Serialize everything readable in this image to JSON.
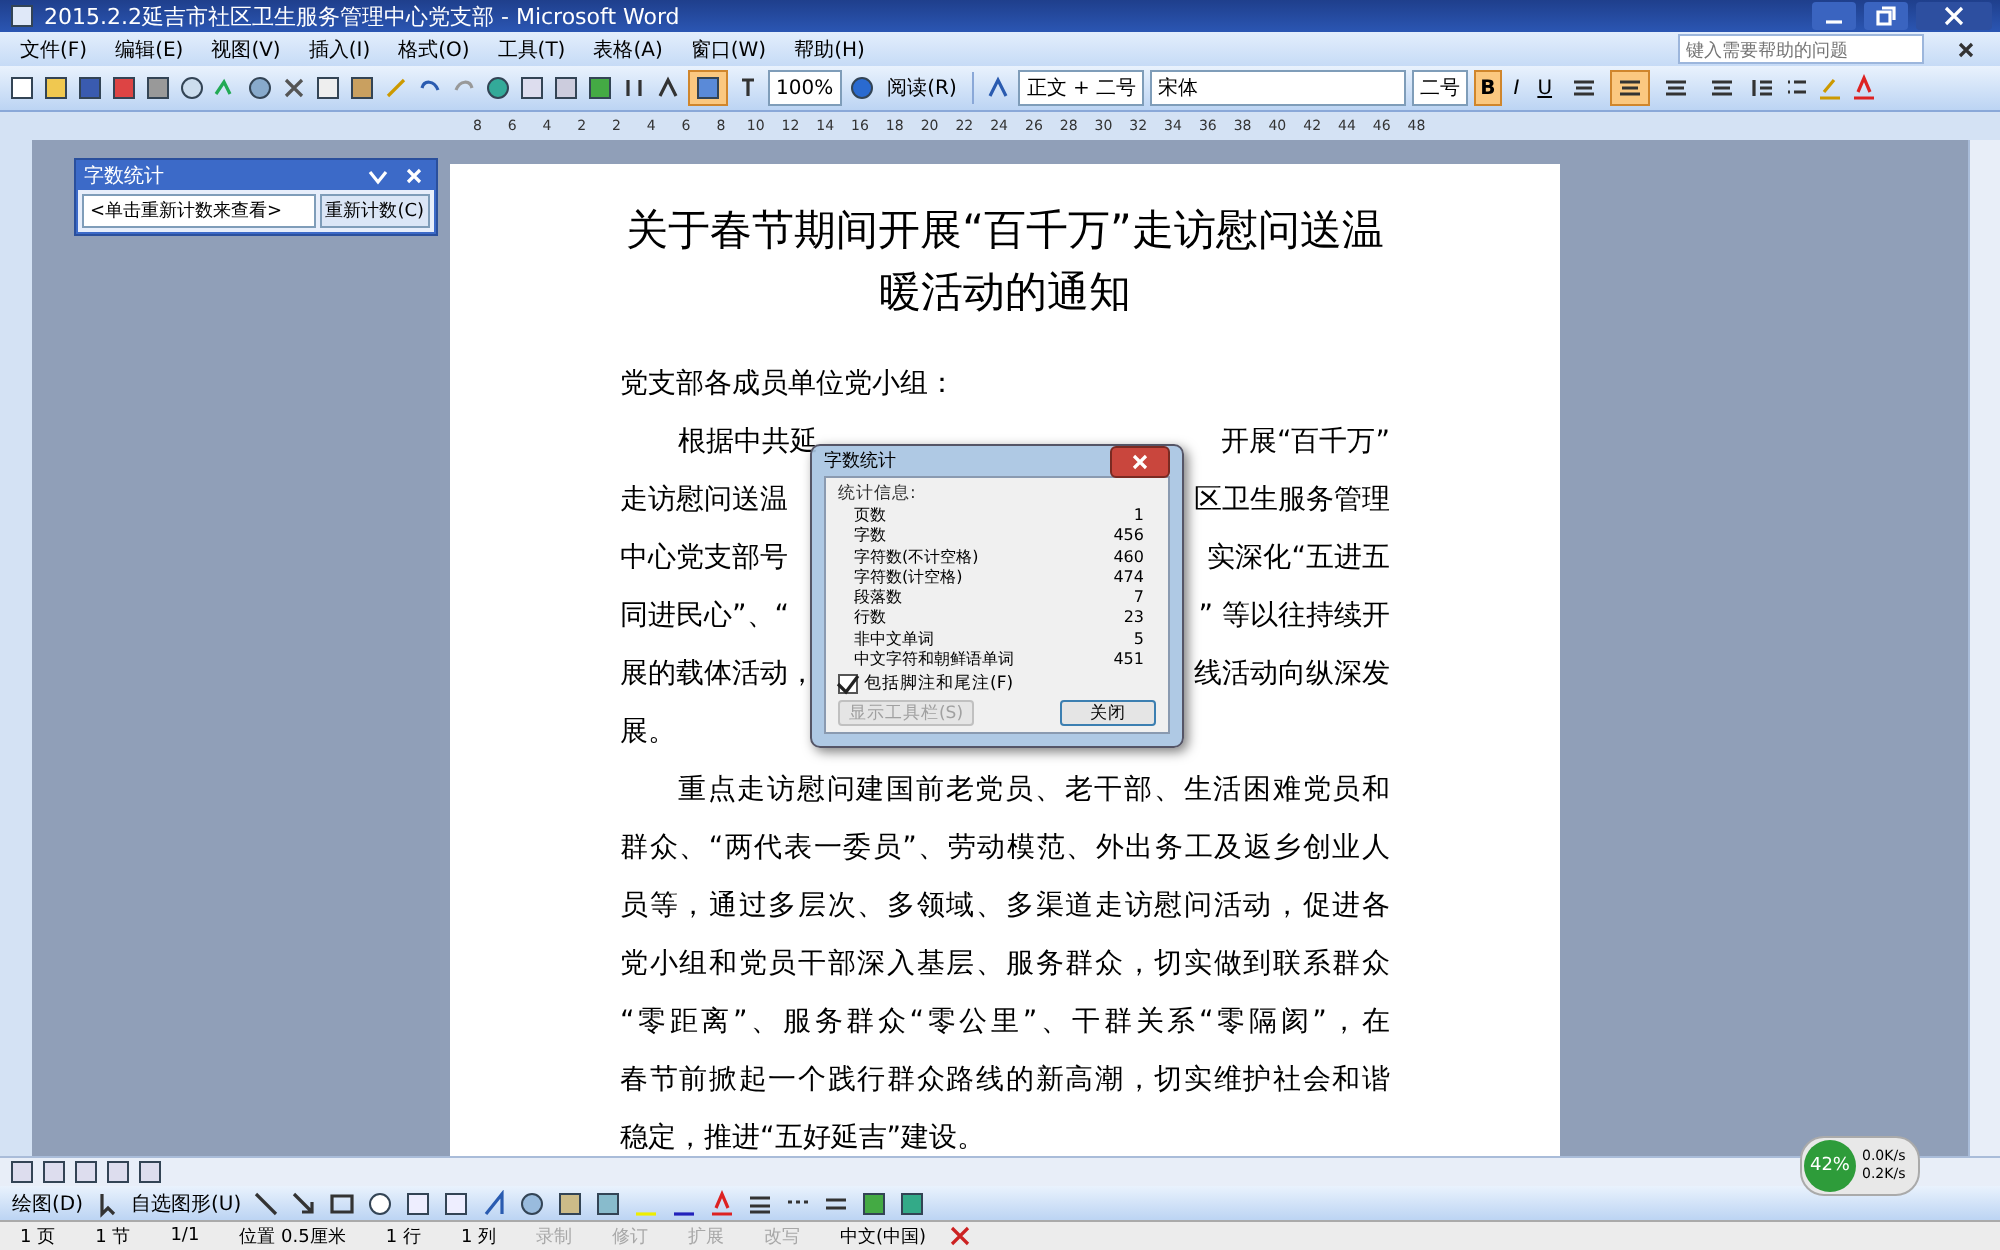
{
  "window": {
    "title": "2015.2.2延吉市社区卫生服务管理中心党支部 - Microsoft Word"
  },
  "menu": [
    "文件(F)",
    "编辑(E)",
    "视图(V)",
    "插入(I)",
    "格式(O)",
    "工具(T)",
    "表格(A)",
    "窗口(W)",
    "帮助(H)"
  ],
  "help_box": {
    "placeholder": "键入需要帮助的问题"
  },
  "standard_toolbar": {
    "zoom": "100%",
    "read_button": "阅读(R)"
  },
  "formatting_toolbar": {
    "style": "正文 + 二号",
    "font": "宋体",
    "size": "二号",
    "text_buttons": [
      {
        "label": "B",
        "selected": true
      },
      {
        "label": "I",
        "selected": false
      },
      {
        "label": "U",
        "selected": false
      }
    ],
    "alignment": [
      {
        "selected": false
      },
      {
        "selected": true
      },
      {
        "selected": false
      },
      {
        "selected": false
      }
    ]
  },
  "ruler": {
    "labels": [
      "8",
      "6",
      "4",
      "2",
      "2",
      "4",
      "6",
      "8",
      "10",
      "12",
      "14",
      "16",
      "18",
      "20",
      "22",
      "24",
      "26",
      "28",
      "30",
      "32",
      "34",
      "36",
      "38",
      "40",
      "42",
      "44",
      "46",
      "48"
    ]
  },
  "word_count_pane": {
    "title": "字数统计",
    "field": "<单击重新计数来查看>",
    "button": "重新计数(C)"
  },
  "document": {
    "title_lines": [
      "关于春节期间开展“百千万”走访慰问送温",
      "暖活动的通知"
    ],
    "salutation": "党支部各成员单位党小组：",
    "lines": [
      {
        "kind": "split",
        "indent": true,
        "left": "根据中共延",
        "right": "开展“百千万”"
      },
      {
        "kind": "split",
        "indent": false,
        "left": "走访慰问送温",
        "right": "区卫生服务管理"
      },
      {
        "kind": "split",
        "indent": false,
        "left": "中心党支部号",
        "right": "实深化“五进五"
      },
      {
        "kind": "split",
        "indent": false,
        "left": "同进民心”、“",
        "right": "” 等以往持续开"
      },
      {
        "kind": "split",
        "indent": false,
        "left": "展的载体活动，",
        "right": "线活动向纵深发"
      },
      {
        "kind": "last",
        "indent": false,
        "text": "展。"
      },
      {
        "kind": "full",
        "indent": true,
        "text": "重点走访慰问建国前老党员、老干部、生活困难党员和"
      },
      {
        "kind": "full",
        "indent": false,
        "text": "群众、“两代表一委员”、劳动模范、外出务工及返乡创业人"
      },
      {
        "kind": "full",
        "indent": false,
        "text": "员等，通过多层次、多领域、多渠道走访慰问活动，促进各"
      },
      {
        "kind": "full",
        "indent": false,
        "text": "党小组和党员干部深入基层、服务群众，切实做到联系群众"
      },
      {
        "kind": "full",
        "indent": false,
        "text": "“零距离”、服务群众“零公里”、干群关系“零隔阂”，在"
      },
      {
        "kind": "full",
        "indent": false,
        "text": "春节前掀起一个践行群众路线的新高潮，切实维护社会和谐"
      },
      {
        "kind": "last",
        "indent": false,
        "text": "稳定，推进“五好延吉”建设。"
      }
    ]
  },
  "dialog": {
    "title": "字数统计",
    "group": "统计信息:",
    "rows": [
      {
        "label": "页数",
        "value": "1"
      },
      {
        "label": "字数",
        "value": "456"
      },
      {
        "label": "字符数(不计空格)",
        "value": "460"
      },
      {
        "label": "字符数(计空格)",
        "value": "474"
      },
      {
        "label": "段落数",
        "value": "7"
      },
      {
        "label": "行数",
        "value": "23"
      },
      {
        "label": "非中文单词",
        "value": "5"
      },
      {
        "label": "中文字符和朝鲜语单词",
        "value": "451"
      }
    ],
    "checkbox": {
      "label": "包括脚注和尾注(F)",
      "checked": true
    },
    "buttons": [
      {
        "label": "显示工具栏(S)",
        "disabled": true
      },
      {
        "label": "关闭",
        "disabled": false
      }
    ]
  },
  "drawing_toolbar": {
    "draw_menu": "绘图(D)",
    "autoshapes_menu": "自选图形(U)"
  },
  "status_bar": {
    "items": [
      {
        "text": "1 页",
        "disabled": false
      },
      {
        "text": "1 节",
        "disabled": false
      },
      {
        "text": "1/1",
        "disabled": false
      },
      {
        "text": "位置 0.5厘米",
        "disabled": false
      },
      {
        "text": "1 行",
        "disabled": false
      },
      {
        "text": "1 列",
        "disabled": false
      },
      {
        "text": "录制",
        "disabled": true
      },
      {
        "text": "修订",
        "disabled": true
      },
      {
        "text": "扩展",
        "disabled": true
      },
      {
        "text": "改写",
        "disabled": true
      },
      {
        "text": "中文(中国)",
        "disabled": false
      }
    ]
  },
  "net_widget": {
    "percent": "42%",
    "down": "0.0K/s",
    "up": "0.2K/s"
  }
}
